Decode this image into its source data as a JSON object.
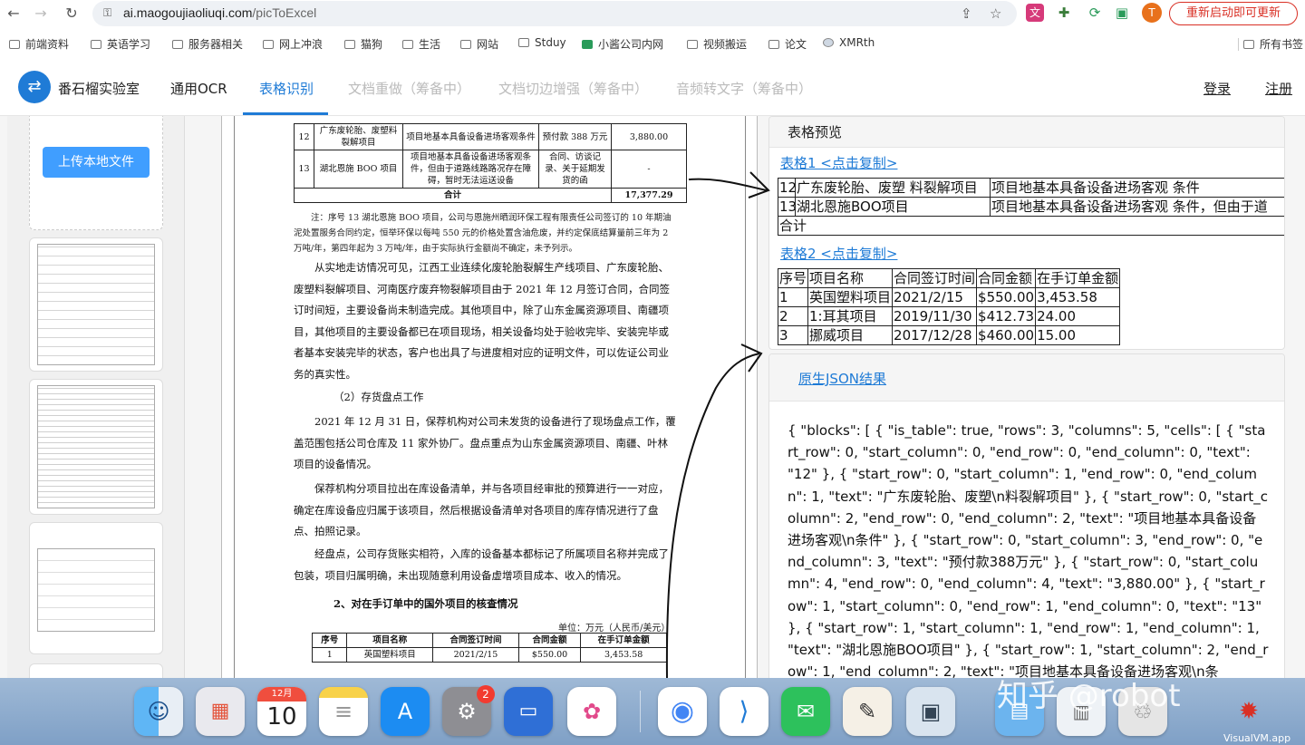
{
  "browser": {
    "url_host": "ai.maogoujiaoliuqi.com",
    "url_path": "/picToExcel",
    "avatar_letter": "T",
    "restart_label": "重新启动即可更新"
  },
  "bookmarks": {
    "items": [
      "前端资料",
      "英语学习",
      "服务器相关",
      "网上冲浪",
      "猫狗",
      "生活",
      "网站",
      "Stduy",
      "小酱公司内网",
      "视频搬运",
      "论文",
      "XMRth"
    ],
    "all_label": "所有书签"
  },
  "app": {
    "logo_glyph": "⇄",
    "brand": "番石榴实验室",
    "nav": [
      "通用OCR",
      "表格识别",
      "文档重做（筹备中）",
      "文档切边增强（筹备中）",
      "音频转文字（筹备中）"
    ],
    "login": "登录",
    "register": "注册",
    "accent": "#1f7bd6"
  },
  "left_panel": {
    "upload_label": "上传本地文件"
  },
  "document": {
    "top_table": [
      [
        "12",
        "广东废轮胎、废塑料裂解项目",
        "项目地基本具备设备进场客观条件",
        "预付款 388 万元",
        "3,880.00"
      ],
      [
        "13",
        "湖北恩施 BOO 项目",
        "项目地基本具备设备进场客观条件，但由于道路线路路况存在障碍，暂时无法运送设备",
        "合同、访谈记录、关于延期发货的函",
        "-"
      ]
    ],
    "total_label": "合计",
    "total_value": "17,377.29",
    "note": "注：序号 13 湖北恩施 BOO 项目，公司与恩施州晒润环保工程有限责任公司签订的 10 年期油泥处置服务合同约定，恒举环保以每吨 550 元的价格处置含油危废，并约定保底结算量前三年为 2 万吨/年，第四年起为 3 万吨/年，由于实际执行金额尚不确定，未予列示。",
    "para1": "从实地走访情况可见，江西工业连续化废轮胎裂解生产线项目、广东废轮胎、废塑料裂解项目、河南医疗废弃物裂解项目由于 2021 年 12 月签订合同，合同签订时间短，主要设备尚未制造完成。其他项目中，除了山东金属资源项目、南疆项目，其他项目的主要设备都已在项目现场，相关设备均处于验收完毕、安装完毕或者基本安装完毕的状态，客户也出具了与进度相对应的证明文件，可以佐证公司业务的真实性。",
    "heading1": "（2）存货盘点工作",
    "para2": "2021 年 12 月 31 日，保荐机构对公司未发货的设备进行了现场盘点工作，覆盖范围包括公司仓库及 11 家外协厂。盘点重点为山东金属资源项目、南疆、叶林项目的设备情况。",
    "para3": "保荐机构分项目拉出在库设备清单，并与各项目经审批的预算进行一一对应，确定在库设备应归属于该项目，然后根据设备清单对各项目的库存情况进行了盘点、拍照记录。",
    "para4": "经盘点，公司存货账实相符，入库的设备基本都标记了所属项目名称并完成了包装，项目归属明确，未出现随意利用设备虚增项目成本、收入的情况。",
    "heading2": "2、对在手订单中的国外项目的核查情况",
    "unit": "单位：万元（人民币/美元）",
    "bottom_header": [
      "序号",
      "项目名称",
      "合同签订时间",
      "合同金额",
      "在手订单金额"
    ],
    "bottom_row": [
      "1",
      "英国塑料项目",
      "2021/2/15",
      "$550.00",
      "3,453.58"
    ]
  },
  "preview": {
    "title": "表格预览",
    "table1_link": "表格1 <点击复制>",
    "table1": [
      [
        "12",
        "广东废轮胎、废塑 料裂解项目",
        "项目地基本具备设备进场客观 条件"
      ],
      [
        "13",
        "湖北恩施BOO项目",
        "项目地基本具备设备进场客观 条件，但由于道"
      ],
      [
        "合计",
        "",
        ""
      ]
    ],
    "table2_link": "表格2 <点击复制>",
    "table2_header": [
      "序号",
      "项目名称",
      "合同签订时间",
      "合同金额",
      "在手订单金额"
    ],
    "table2_rows": [
      [
        "1",
        "英国塑料项目",
        "2021/2/15",
        "$550.00",
        "3,453.58"
      ],
      [
        "2",
        "1:耳其项目",
        "2019/11/30",
        "$412.73",
        "24.00"
      ],
      [
        "3",
        "挪威项目",
        "2017/12/28",
        "$460.00",
        "15.00"
      ]
    ]
  },
  "json_result": {
    "link": "原生JSON结果",
    "text": "{ \"blocks\": [ { \"is_table\": true, \"rows\": 3, \"columns\": 5, \"cells\": [ { \"start_row\": 0, \"start_column\": 0, \"end_row\": 0, \"end_column\": 0, \"text\": \"12\" }, { \"start_row\": 0, \"start_column\": 1, \"end_row\": 0, \"end_column\": 1, \"text\": \"广东废轮胎、废塑\\n料裂解项目\" }, { \"start_row\": 0, \"start_column\": 2, \"end_row\": 0, \"end_column\": 2, \"text\": \"项目地基本具备设备进场客观\\n条件\" }, { \"start_row\": 0, \"start_column\": 3, \"end_row\": 0, \"end_column\": 3, \"text\": \"预付款388万元\" }, { \"start_row\": 0, \"start_column\": 4, \"end_row\": 0, \"end_column\": 4, \"text\": \"3,880.00\" }, { \"start_row\": 1, \"start_column\": 0, \"end_row\": 1, \"end_column\": 0, \"text\": \"13\" }, { \"start_row\": 1, \"start_column\": 1, \"end_row\": 1, \"end_column\": 1, \"text\": \"湖北恩施BOO项目\" }, { \"start_row\": 1, \"start_column\": 2, \"end_row\": 1, \"end_column\": 2, \"text\": \"项目地基本具备设备进场客观\\n条"
  },
  "dock": {
    "calendar_month": "12月",
    "calendar_day": "10",
    "settings_badge": "2",
    "watermark": "知乎 @robot",
    "vm_label": "VisualVM.app"
  }
}
